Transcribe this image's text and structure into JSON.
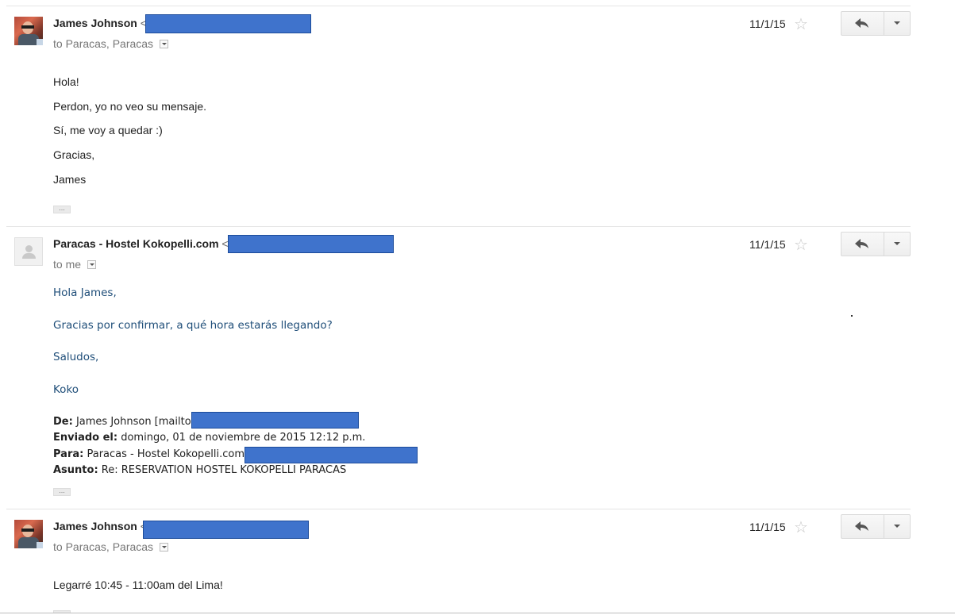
{
  "messages": [
    {
      "sender": "James Johnson",
      "sender_suffix": "<",
      "date": "11/1/15",
      "to_line": "to Paracas, Paracas",
      "body": [
        "Hola!",
        "Perdon, yo no veo su mensaje.",
        "Sí, me voy a quedar :)",
        "Gracias,",
        "James"
      ],
      "trimmed": "..."
    },
    {
      "sender": "Paracas - Hostel Kokopelli.com",
      "sender_suffix": "<",
      "date": "11/1/15",
      "to_line": "to me",
      "body": [
        "Hola James,",
        "Gracias por confirmar, a qué hora estarás llegando?",
        "Saludos,",
        "Koko"
      ],
      "quoted_header": {
        "de_label": "De:",
        "de_value": "James Johnson [mailto",
        "enviado_label": "Enviado el:",
        "enviado_value": "domingo, 01 de noviembre de 2015 12:12 p.m.",
        "para_label": "Para:",
        "para_value": "Paracas - Hostel Kokopelli.com",
        "asunto_label": "Asunto:",
        "asunto_value": "Re: RESERVATION HOSTEL KOKOPELLI PARACAS"
      },
      "trimmed": "..."
    },
    {
      "sender": "James Johnson",
      "sender_suffix": "<",
      "date": "11/1/15",
      "to_line": "to Paracas, Paracas",
      "body": [
        "Legarré 10:45 - 11:00am del Lima!"
      ],
      "trimmed": "..."
    }
  ],
  "icons": {
    "star": "☆",
    "reply": "reply-arrow-icon",
    "more": "chevron-down-icon"
  },
  "colors": {
    "redaction": "#3f73cc",
    "quoted_text": "#1f4e79"
  }
}
